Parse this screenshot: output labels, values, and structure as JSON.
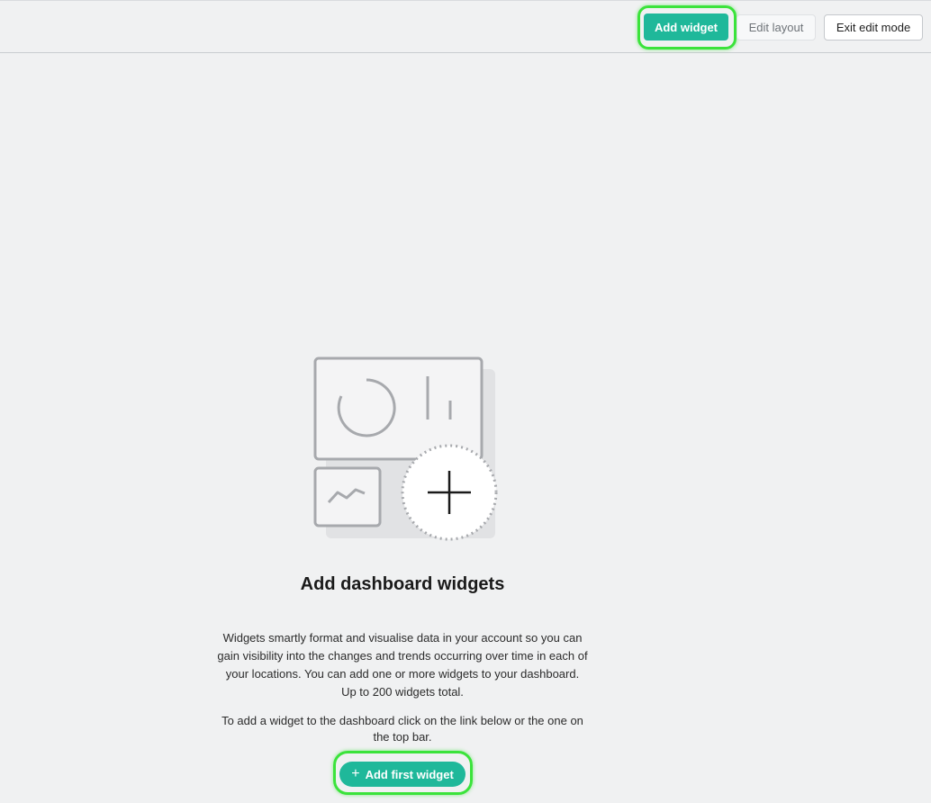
{
  "toolbar": {
    "add_widget_label": "Add widget",
    "edit_layout_label": "Edit layout",
    "exit_edit_mode_label": "Exit edit mode"
  },
  "empty_state": {
    "illustration_icon": "dashboard-widgets-illustration-icon",
    "plus_icon": "plus-icon",
    "title": "Add dashboard widgets",
    "description_lines": [
      "Widgets smartly format and visualise data in your account so you can",
      "gain visibility into the changes and trends occurring over time in each of",
      "your locations. You can add one or more widgets to your dashboard.",
      "Up to 200 widgets total."
    ],
    "hint_lines": [
      "To add a widget to the dashboard click on the link below or the one on",
      "the top bar."
    ],
    "add_first_widget_label": "Add first widget"
  },
  "colors": {
    "background": "#f0f1f2",
    "accent": "#1fb89a",
    "highlight": "#3be33b"
  }
}
